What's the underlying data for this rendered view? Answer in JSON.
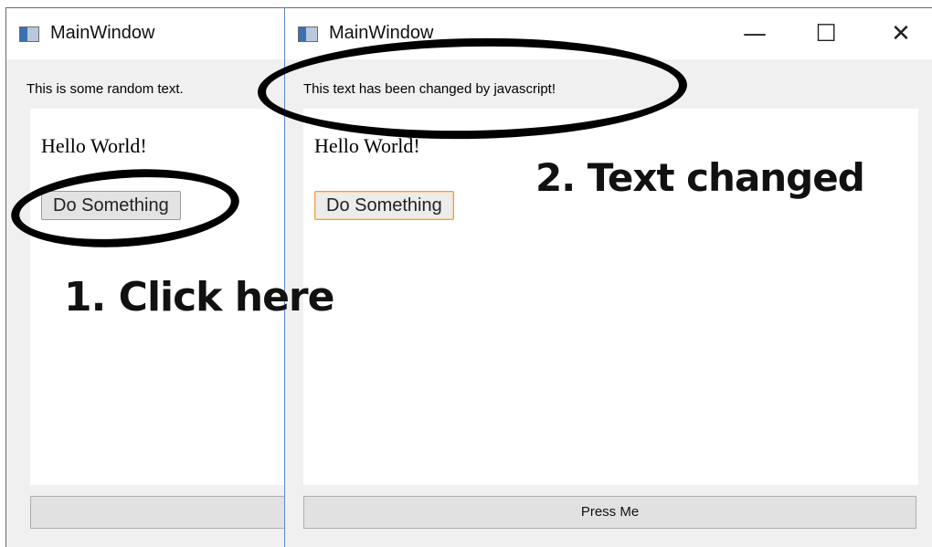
{
  "windows": {
    "left": {
      "title": "MainWindow",
      "label_text": "This is some random text.",
      "hello_text": "Hello World!",
      "do_button": "Do Something",
      "press_button": ""
    },
    "right": {
      "title": "MainWindow",
      "label_text": "This text has been changed by javascript!",
      "hello_text": "Hello World!",
      "do_button": "Do Something",
      "press_button": "Press Me",
      "controls": {
        "minimize": "—",
        "maximize": "☐",
        "close": "✕"
      }
    }
  },
  "annotations": {
    "step1": "1. Click here",
    "step2": "2. Text changed"
  }
}
